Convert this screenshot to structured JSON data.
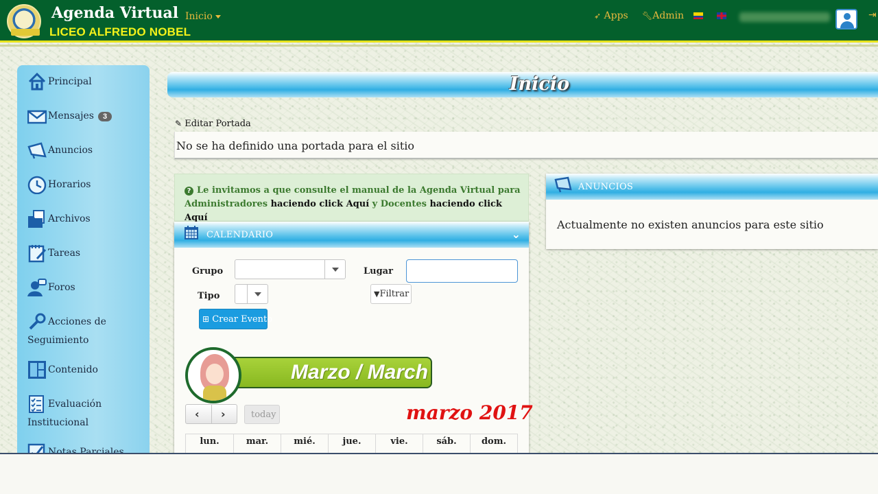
{
  "header": {
    "title": "Agenda Virtual",
    "school": "LICEO ALFREDO NOBEL",
    "nav_inicio": "Inicio",
    "apps": "Apps",
    "admin": "Admin"
  },
  "sidebar": {
    "items": [
      {
        "label": "Principal",
        "icon": "home-icon"
      },
      {
        "label": "Mensajes",
        "icon": "envelope-icon",
        "badge": "3"
      },
      {
        "label": "Anuncios",
        "icon": "megaphone-icon"
      },
      {
        "label": "Horarios",
        "icon": "clock-icon"
      },
      {
        "label": "Archivos",
        "icon": "folder-icon"
      },
      {
        "label": "Tareas",
        "icon": "notepad-icon"
      },
      {
        "label": "Foros",
        "icon": "forum-user-icon"
      },
      {
        "label": "Acciones de",
        "label2": "Seguimiento",
        "icon": "tools-icon"
      },
      {
        "label": "Contenido",
        "icon": "layout-icon"
      },
      {
        "label": "Evaluación",
        "label2": "Institucional",
        "icon": "checklist-icon"
      },
      {
        "label": "Notas Parciales",
        "icon": "grades-icon"
      }
    ]
  },
  "main": {
    "page_title": "Inicio",
    "edit_portada": "Editar Portada",
    "portada_text": "No se ha definido una portada para el sitio",
    "alert": {
      "part1": "Le invitamos a que consulte el manual de la Agenda Virtual para",
      "admins": "Administradores",
      "click1": "haciendo click Aquí",
      "y": "y",
      "docentes": "Docentes",
      "click2": "haciendo click Aquí"
    },
    "calendar": {
      "header": "CALENDARIO",
      "grupo_label": "Grupo",
      "lugar_label": "Lugar",
      "tipo_label": "Tipo",
      "filtrar": "Filtrar",
      "crear_evento": "Crear Evento",
      "banner": "Marzo / March",
      "today": "today",
      "title": "marzo 2017",
      "days": [
        "lun.",
        "mar.",
        "mié.",
        "jue.",
        "vie.",
        "sáb.",
        "dom."
      ]
    },
    "anuncios": {
      "header": "ANUNCIOS",
      "empty": "Actualmente no existen anuncios para este sitio"
    }
  },
  "colors": {
    "navbar": "#04602c",
    "brand_yellow": "#f4f21a",
    "nav_gold": "#e9b93e",
    "accent_blue": "#1b9ce0",
    "calendar_title_red": "#e01212"
  }
}
